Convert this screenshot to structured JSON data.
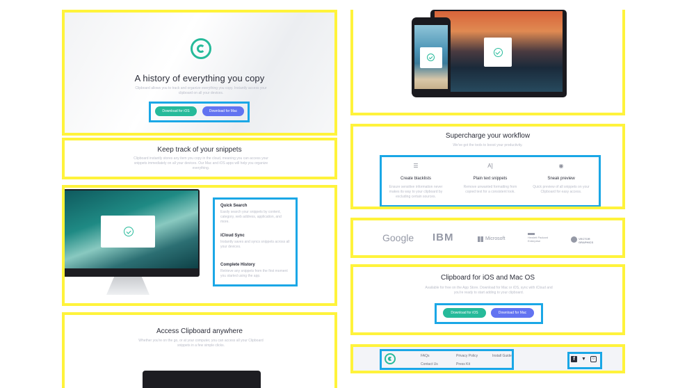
{
  "hero": {
    "title": "A history of everything you copy",
    "subtitle": "Clipboard allows you to track and organize everything you copy. Instantly access your clipboard on all your devices.",
    "ios_button": "Download for iOS",
    "mac_button": "Download for Mac"
  },
  "snippets": {
    "title": "Keep track of your snippets",
    "text": "Clipboard instantly stores any item you copy in the cloud, meaning you can access your snippets immediately on all your devices. Our Mac and iOS apps will help you organize everything."
  },
  "features": [
    {
      "title": "Quick Search",
      "text": "Easily search your snippets by content, category, web address, application, and more."
    },
    {
      "title": "iCloud Sync",
      "text": "Instantly saves and syncs snippets across all your devices."
    },
    {
      "title": "Complete History",
      "text": "Retrieve any snippets from the first moment you started using the app."
    }
  ],
  "access": {
    "title": "Access Clipboard anywhere",
    "text": "Whether you're on the go, or at your computer, you can access all your Clipboard snippets in a few simple clicks."
  },
  "workflow": {
    "title": "Supercharge your workflow",
    "subtitle": "We've got the tools to boost your productivity.",
    "items": [
      {
        "icon": "blacklist-icon",
        "glyph": "☰",
        "title": "Create blacklists",
        "text": "Ensure sensitive information never makes its way to your clipboard by excluding certain sources."
      },
      {
        "icon": "text-snippet-icon",
        "glyph": "A]",
        "title": "Plain text snippets",
        "text": "Remove unwanted formatting from copied text for a consistent look."
      },
      {
        "icon": "eye-icon",
        "glyph": "◉",
        "title": "Sneak preview",
        "text": "Quick preview of all snippets on your Clipboard for easy access."
      }
    ]
  },
  "brands": [
    "Google",
    "IBM",
    "Microsoft",
    "Hewlett Packard Enterprise",
    "VECTOR GRAPHICS"
  ],
  "cta": {
    "title": "Clipboard for iOS and Mac OS",
    "text": "Available for free on the App Store. Download for Mac or iOS, sync with iCloud and you're ready to start adding to your clipboard.",
    "ios_button": "Download for iOS",
    "mac_button": "Download for Mac"
  },
  "footer": {
    "links": [
      "FAQs",
      "Contact Us",
      "Privacy Policy",
      "Press Kit",
      "Install Guide"
    ],
    "social": [
      "facebook-icon",
      "twitter-icon",
      "instagram-icon"
    ]
  },
  "colors": {
    "highlight_yellow": "#fff33b",
    "highlight_blue": "#1aa7e6",
    "accent_green": "#26ba9a",
    "accent_blue": "#6273f1"
  }
}
